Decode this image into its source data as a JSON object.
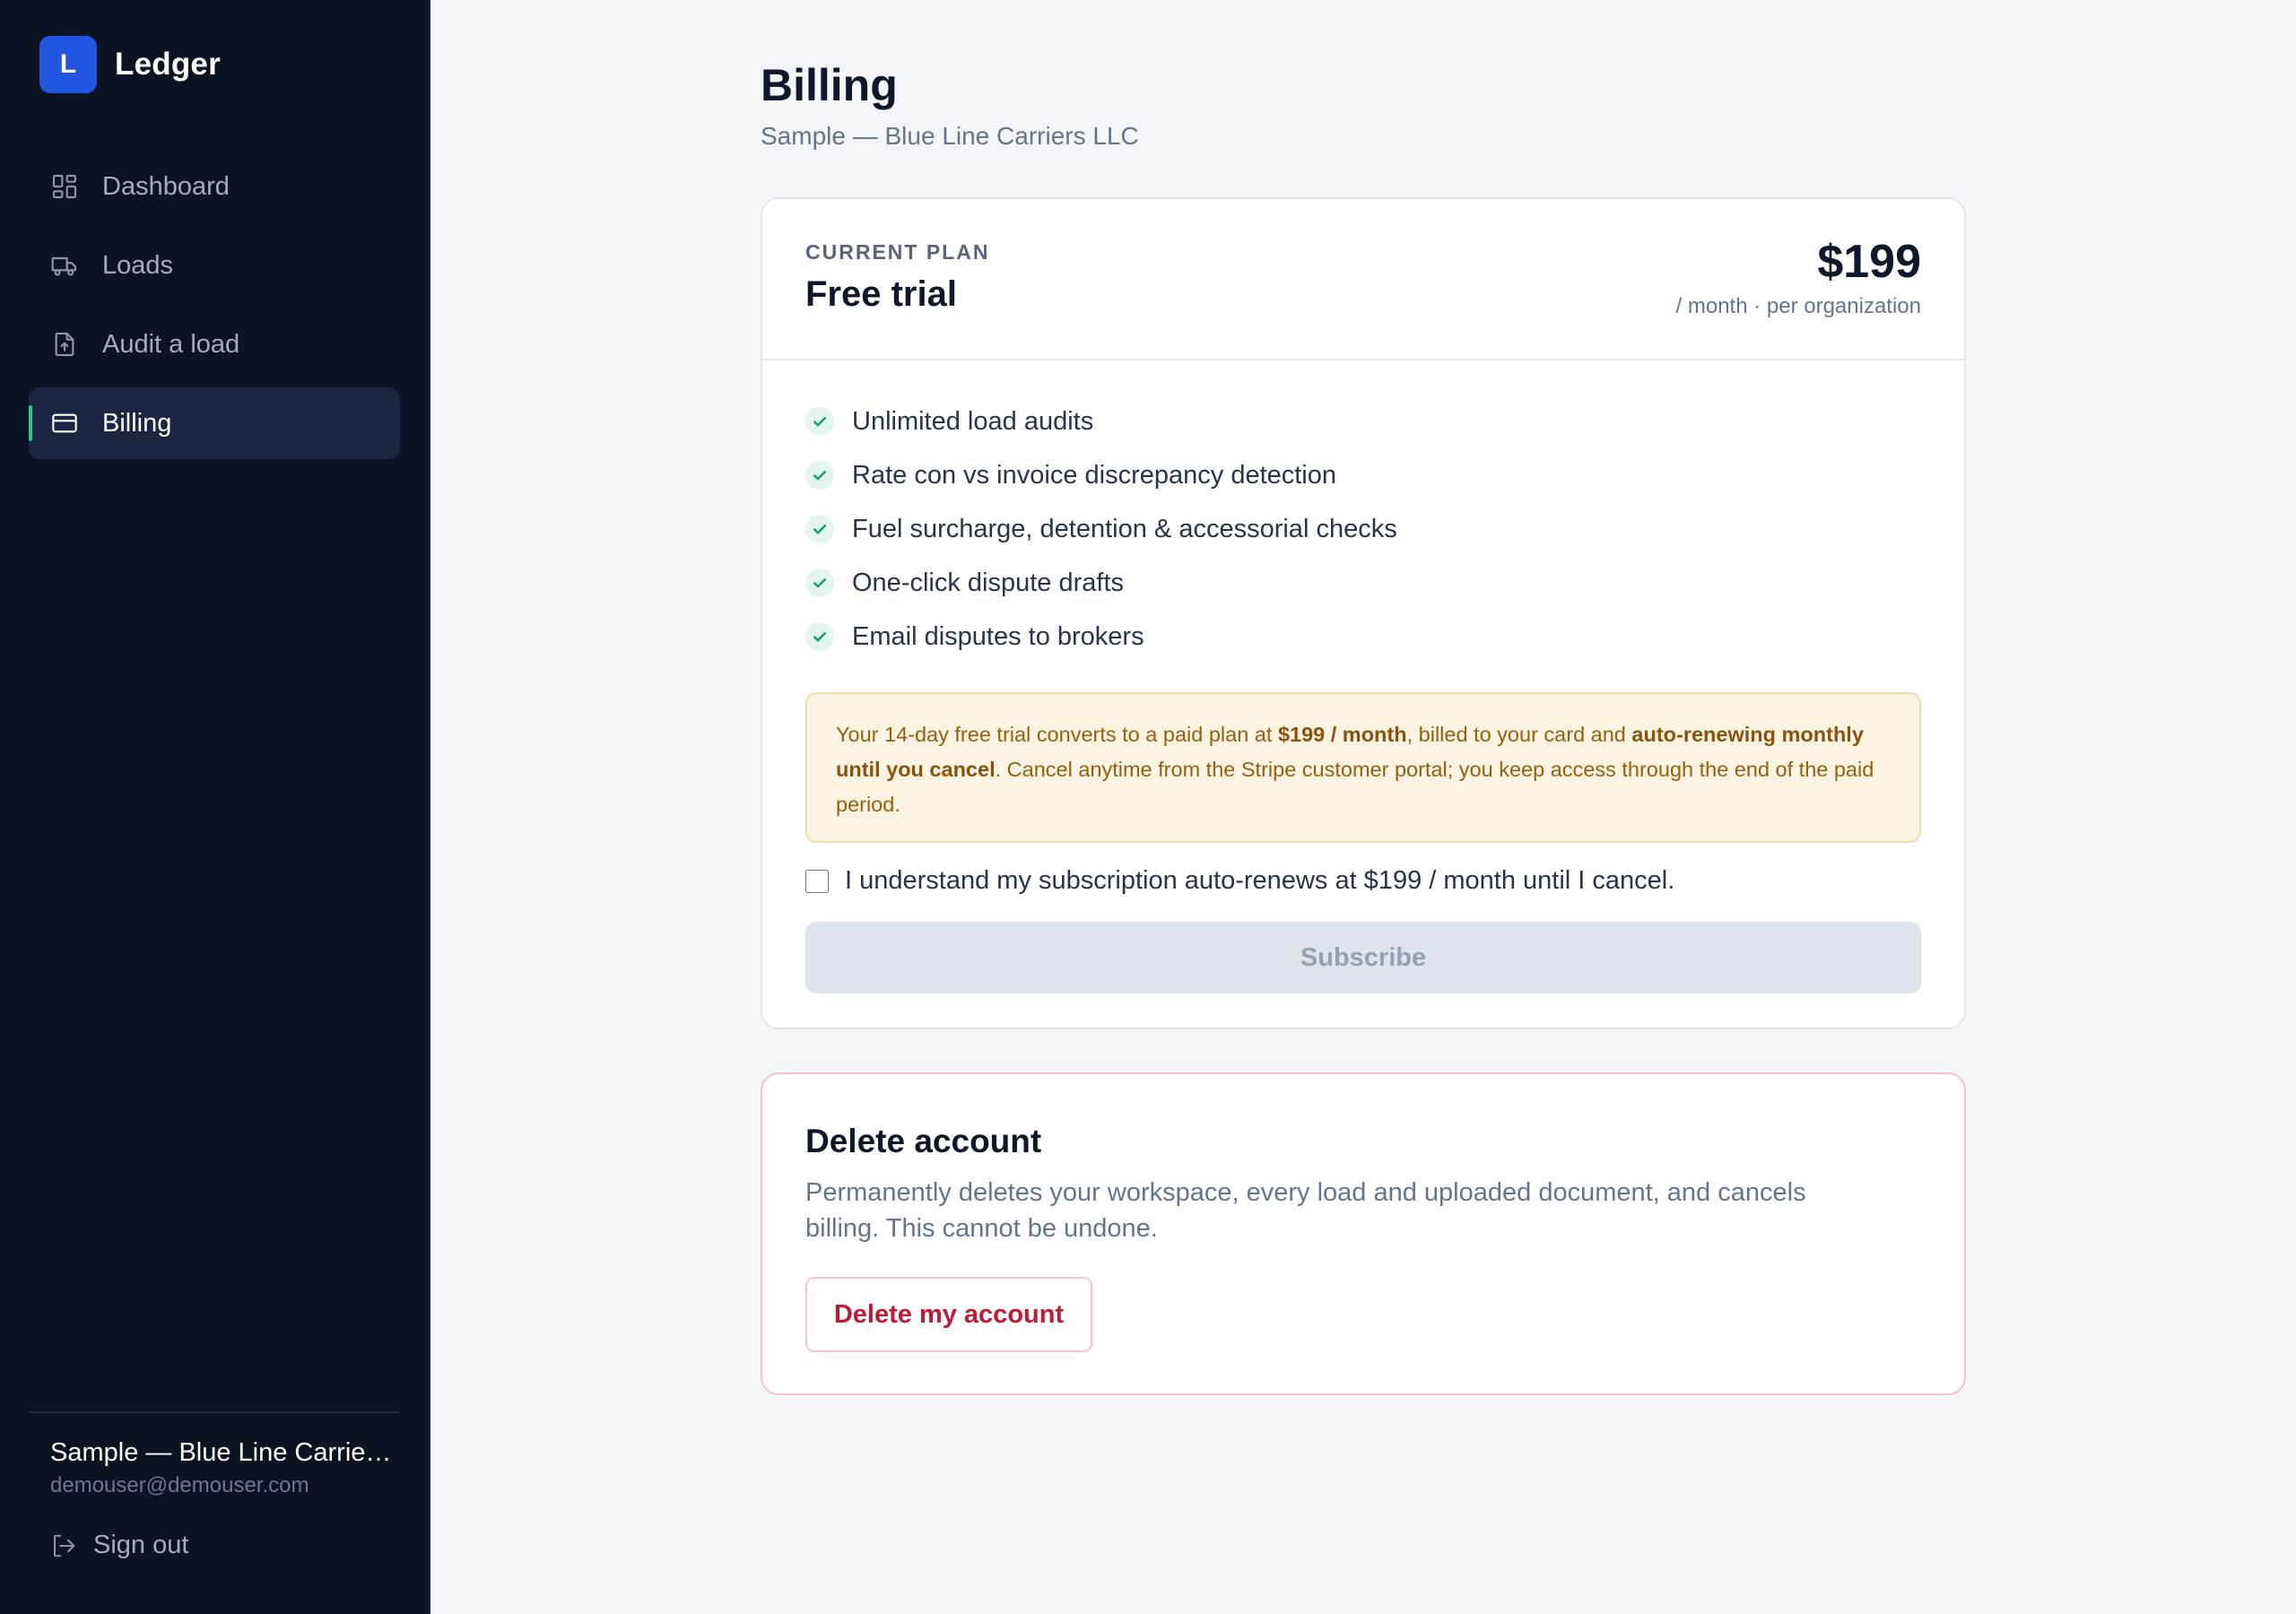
{
  "brand": {
    "logo_letter": "L",
    "name": "Ledger",
    "logo_color": "#2255e0"
  },
  "sidebar": {
    "items": [
      {
        "label": "Dashboard",
        "icon": "dashboard-grid-icon"
      },
      {
        "label": "Loads",
        "icon": "truck-icon"
      },
      {
        "label": "Audit a load",
        "icon": "file-upload-icon"
      },
      {
        "label": "Billing",
        "icon": "credit-card-icon",
        "active": true
      }
    ],
    "active_accent": "#2fc98c",
    "user": {
      "name": "Sample — Blue Line Carriers LLC",
      "email": "demouser@demouser.com"
    },
    "sign_out": {
      "label": "Sign out",
      "icon": "sign-out-icon"
    }
  },
  "page": {
    "title": "Billing",
    "subtitle": "Sample — Blue Line Carriers LLC"
  },
  "plan": {
    "label": "CURRENT PLAN",
    "name": "Free trial",
    "price": "$199",
    "period": "/ month · per organization",
    "features": [
      "Unlimited load audits",
      "Rate con vs invoice discrepancy detection",
      "Fuel surcharge, detention & accessorial checks",
      "One-click dispute drafts",
      "Email disputes to brokers"
    ],
    "notice": {
      "part1": "Your 14-day free trial converts to a paid plan at ",
      "bold1": "$199 / month",
      "part2": ", billed to your card and ",
      "bold2": "auto-renewing monthly until you cancel",
      "part3": ". Cancel anytime from the Stripe customer portal; you keep access through the end of the paid period."
    },
    "consent_label": "I understand my subscription auto-renews at $199 / month until I cancel.",
    "consent_checked": false,
    "subscribe_label": "Subscribe",
    "subscribe_disabled": true
  },
  "danger": {
    "title": "Delete account",
    "description": "Permanently deletes your workspace, every load and uploaded document, and cancels billing. This cannot be undone.",
    "button_label": "Delete my account",
    "accent": "#c01939"
  }
}
